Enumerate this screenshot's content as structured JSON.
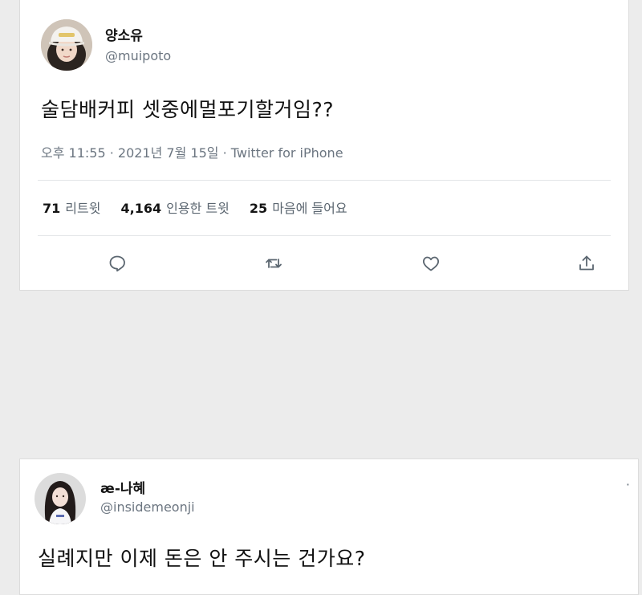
{
  "tweet": {
    "author_name": "양소유",
    "author_handle": "@muipoto",
    "text": "술담배커피 셋중에멀포기할거임??",
    "meta": "오후 11:55 · 2021년 7월 15일 · Twitter for iPhone",
    "stats": {
      "retweets_count": "71",
      "retweets_label": "리트윗",
      "quotes_count": "4,164",
      "quotes_label": "인용한 트윗",
      "likes_count": "25",
      "likes_label": "마음에 들어요"
    },
    "actions": [
      "reply-icon",
      "retweet-icon",
      "like-icon",
      "share-icon"
    ]
  },
  "reply": {
    "author_name": "æ-나혜",
    "author_handle": "@insidemeonji",
    "text": "실례지만 이제 돈은 안 주시는 건가요?",
    "more_label": "·"
  },
  "colors": {
    "background": "#ececec",
    "card": "#ffffff",
    "secondary_text": "#6b7580",
    "icon": "#5b6670"
  }
}
